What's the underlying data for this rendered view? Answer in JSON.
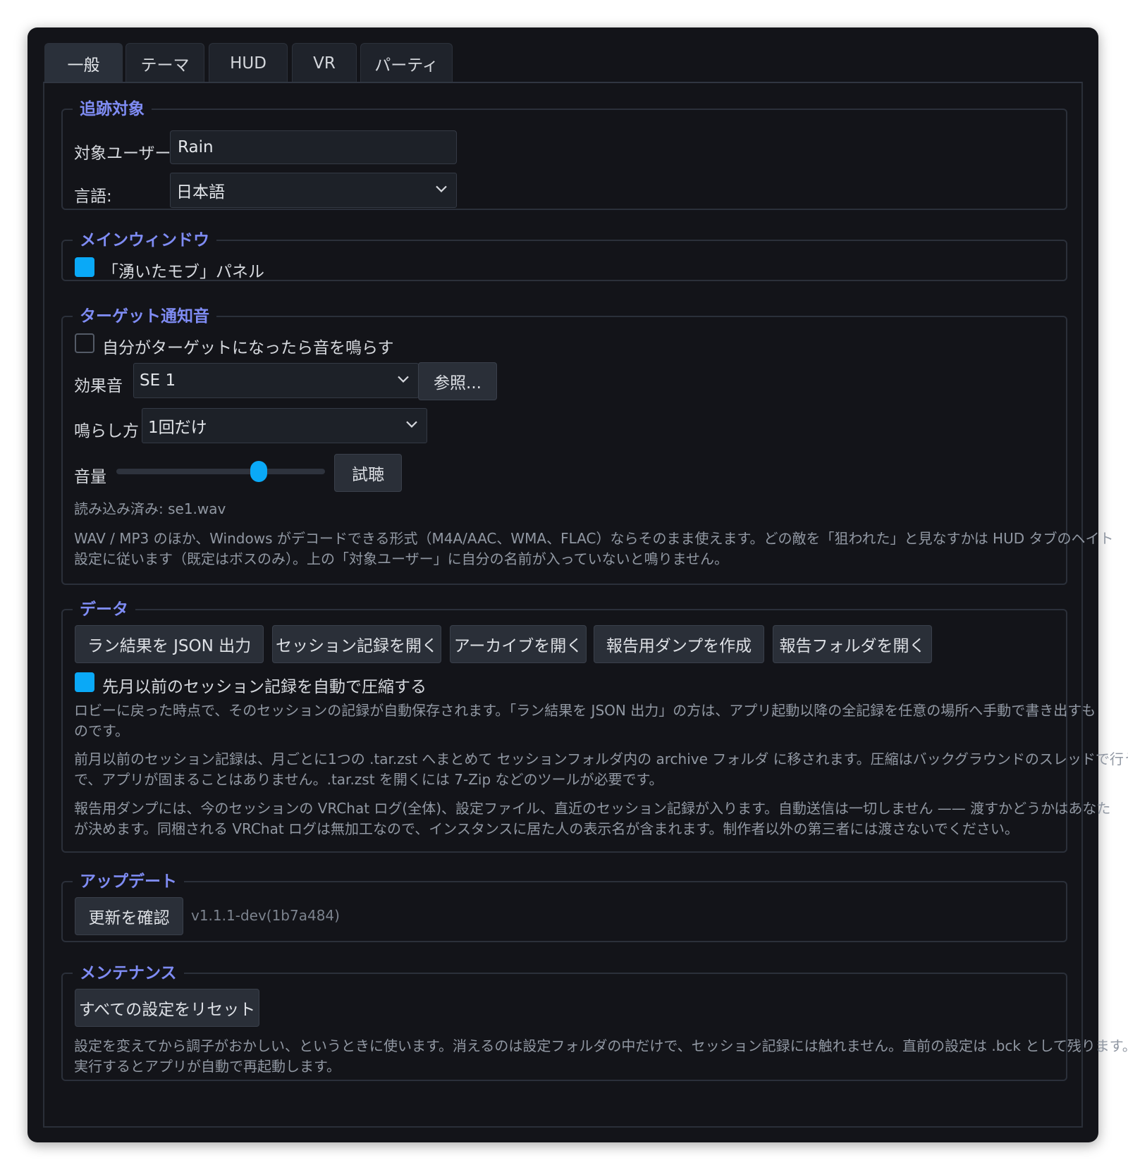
{
  "tabs": [
    "一般",
    "テーマ",
    "HUD",
    "VR",
    "パーティ"
  ],
  "tracking": {
    "title": "追跡対象",
    "user_label": "対象ユーザー:",
    "user_value": "Rain",
    "language_label": "言語:",
    "language_value": "日本語"
  },
  "main_window": {
    "title": "メインウィンドウ",
    "mob_panel_label": "「湧いたモブ」パネル",
    "mob_panel_checked": true
  },
  "target_sound": {
    "title": "ターゲット通知音",
    "play_on_target_label": "自分がターゲットになったら音を鳴らす",
    "play_on_target_checked": false,
    "effect_label": "効果音",
    "effect_value": "SE 1",
    "browse_label": "参照...",
    "play_mode_label": "鳴らし方",
    "play_mode_value": "1回だけ",
    "volume_label": "音量",
    "volume_level": 0.7,
    "preview_label": "試聴",
    "loaded_text": "読み込み済み: se1.wav",
    "help_line1": "WAV / MP3 のほか、Windows がデコードできる形式（M4A/AAC、WMA、FLAC）ならそのまま使えます。どの敵を「狙われた」と見なすかは HUD タブのヘイト",
    "help_line2": "設定に従います（既定はボスのみ）。上の「対象ユーザー」に自分の名前が入っていないと鳴りません。"
  },
  "data_section": {
    "title": "データ",
    "buttons": [
      "ラン結果を JSON 出力",
      "セッション記録を開く",
      "アーカイブを開く",
      "報告用ダンプを作成",
      "報告フォルダを開く"
    ],
    "compress_label": "先月以前のセッション記録を自動で圧縮する",
    "compress_checked": true,
    "note1_line1": "ロビーに戻った時点で、そのセッションの記録が自動保存されます。「ラン結果を JSON 出力」の方は、アプリ起動以降の全記録を任意の場所へ手動で書き出すも",
    "note1_line2": "のです。",
    "note2_line1": "前月以前のセッション記録は、月ごとに1つの .tar.zst へまとめて セッションフォルダ内の archive フォルダ に移されます。圧縮はバックグラウンドのスレッドで行うの",
    "note2_line2": "で、アプリが固まることはありません。.tar.zst を開くには 7-Zip などのツールが必要です。",
    "note3_line1": "報告用ダンプには、今のセッションの VRChat ログ(全体)、設定ファイル、直近のセッション記録が入ります。自動送信は一切しません —— 渡すかどうかはあなた",
    "note3_line2": "が決めます。同梱される VRChat ログは無加工なので、インスタンスに居た人の表示名が含まれます。制作者以外の第三者には渡さないでください。"
  },
  "update": {
    "title": "アップデート",
    "check_label": "更新を確認",
    "version": "v1.1.1-dev(1b7a484)"
  },
  "maintenance": {
    "title": "メンテナンス",
    "reset_label": "すべての設定をリセット",
    "note_line1": "設定を変えてから調子がおかしい、というときに使います。消えるのは設定フォルダの中だけで、セッション記録には触れません。直前の設定は .bck として残ります。",
    "note_line2": "実行するとアプリが自動で再起動します。"
  },
  "colors": {
    "accent": "#0aa9f7",
    "legend": "#7f8cf4",
    "background": "#131419"
  },
  "icons": [
    "chevron-down-icon"
  ]
}
